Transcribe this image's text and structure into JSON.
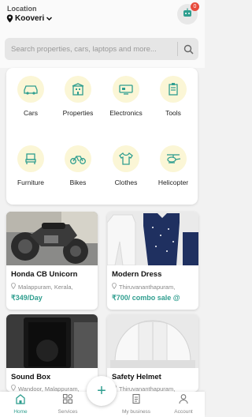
{
  "header": {
    "location_label": "Location",
    "location_value": "Kooveri",
    "notification_count": "0"
  },
  "search": {
    "placeholder": "Search properties, cars, laptops and more..."
  },
  "categories": [
    {
      "label": "Cars",
      "icon": "car-icon"
    },
    {
      "label": "Properties",
      "icon": "building-icon"
    },
    {
      "label": "Electronics",
      "icon": "electronics-icon"
    },
    {
      "label": "Tools",
      "icon": "tools-icon"
    },
    {
      "label": "Furniture",
      "icon": "furniture-icon"
    },
    {
      "label": "Bikes",
      "icon": "bike-icon"
    },
    {
      "label": "Clothes",
      "icon": "clothes-icon"
    },
    {
      "label": "Helicopter",
      "icon": "helicopter-icon"
    }
  ],
  "listings": [
    {
      "title": "Honda CB Unicorn",
      "location": "Malappuram, Kerala,",
      "price": "₹349/Day"
    },
    {
      "title": "Modern Dress",
      "location": "Thiruvananthapuram,",
      "price": "₹700/ combo sale @"
    },
    {
      "title": "Sound Box",
      "location": "Wandoor, Malappuram,",
      "price": ""
    },
    {
      "title": "Safety Helmet",
      "location": "Thiruvananthapuram,",
      "price": ""
    }
  ],
  "nav": {
    "home": "Home",
    "services": "Services",
    "my_business": "My business",
    "account": "Account",
    "fab": "+"
  },
  "colors": {
    "accent": "#2f9e8f",
    "category_circle": "#fbf6d6",
    "badge": "#e84b3c"
  }
}
